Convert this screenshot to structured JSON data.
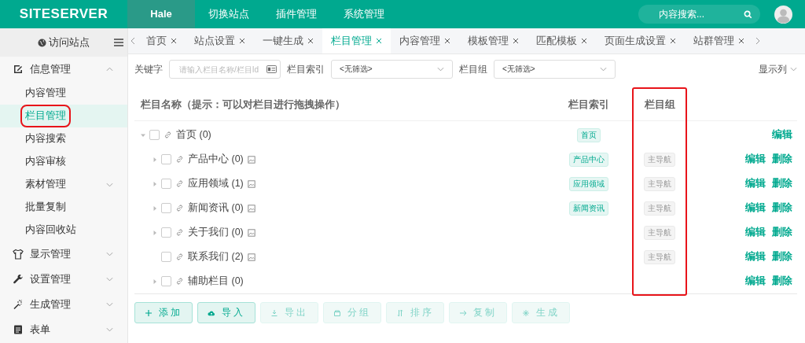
{
  "header": {
    "logo": "SITESERVER",
    "nav": [
      {
        "label": "Hale",
        "selected": true
      },
      {
        "label": "切换站点",
        "selected": false
      },
      {
        "label": "插件管理",
        "selected": false
      },
      {
        "label": "系统管理",
        "selected": false
      }
    ],
    "search": {
      "placeholder": "内容搜索..."
    }
  },
  "sidebar": {
    "visit": "访问站点",
    "groups": [
      {
        "label": "信息管理",
        "expanded": true,
        "items": [
          {
            "label": "内容管理",
            "selected": false,
            "highlighted": false,
            "expandable": false
          },
          {
            "label": "栏目管理",
            "selected": true,
            "highlighted": true,
            "expandable": false
          },
          {
            "label": "内容搜索",
            "selected": false,
            "highlighted": false,
            "expandable": false
          },
          {
            "label": "内容审核",
            "selected": false,
            "highlighted": false,
            "expandable": false
          },
          {
            "label": "素材管理",
            "selected": false,
            "highlighted": false,
            "expandable": true
          },
          {
            "label": "批量复制",
            "selected": false,
            "highlighted": false,
            "expandable": false
          },
          {
            "label": "内容回收站",
            "selected": false,
            "highlighted": false,
            "expandable": false
          }
        ]
      },
      {
        "label": "显示管理",
        "expanded": false
      },
      {
        "label": "设置管理",
        "expanded": false
      },
      {
        "label": "生成管理",
        "expanded": false
      },
      {
        "label": "表单",
        "expanded": false
      }
    ]
  },
  "tabs": [
    {
      "label": "首页",
      "selected": false
    },
    {
      "label": "站点设置",
      "selected": false
    },
    {
      "label": "一键生成",
      "selected": false
    },
    {
      "label": "栏目管理",
      "selected": true
    },
    {
      "label": "内容管理",
      "selected": false
    },
    {
      "label": "模板管理",
      "selected": false
    },
    {
      "label": "匹配模板",
      "selected": false
    },
    {
      "label": "页面生成设置",
      "selected": false
    },
    {
      "label": "站群管理",
      "selected": false
    }
  ],
  "filters": [
    {
      "label": "关键字",
      "kind": "input",
      "placeholder": "请输入栏目名称/栏目Id"
    },
    {
      "label": "栏目索引",
      "kind": "select",
      "value": "<无筛选>"
    },
    {
      "label": "栏目组",
      "kind": "select",
      "value": "<无筛选>"
    }
  ],
  "columns_toggle": "显示列",
  "table": {
    "columns": [
      {
        "label": "栏目名称（提示：可以对栏目进行拖拽操作）"
      },
      {
        "label": "栏目索引"
      },
      {
        "label": "栏目组",
        "highlighted": true
      }
    ],
    "rows": [
      {
        "name": "首页",
        "count": "(0)",
        "checked": false,
        "expandable": true,
        "expanded": true,
        "has_image": false,
        "index": "首页",
        "actions": [
          "编辑"
        ],
        "children": [
          {
            "name": "产品中心",
            "count": "(0)",
            "checked": false,
            "expandable": true,
            "has_image": true,
            "index": "产品中心",
            "group": "主导航",
            "actions": [
              "编辑",
              "删除"
            ]
          },
          {
            "name": "应用领域",
            "count": "(1)",
            "checked": false,
            "expandable": true,
            "has_image": true,
            "index": "应用领域",
            "group": "主导航",
            "actions": [
              "编辑",
              "删除"
            ]
          },
          {
            "name": "新闻资讯",
            "count": "(0)",
            "checked": false,
            "expandable": true,
            "has_image": true,
            "index": "新闻资讯",
            "group": "主导航",
            "actions": [
              "编辑",
              "删除"
            ]
          },
          {
            "name": "关于我们",
            "count": "(0)",
            "checked": false,
            "expandable": true,
            "has_image": true,
            "group": "主导航",
            "actions": [
              "编辑",
              "删除"
            ]
          },
          {
            "name": "联系我们",
            "count": "(2)",
            "checked": false,
            "expandable": false,
            "has_image": true,
            "group": "主导航",
            "actions": [
              "编辑",
              "删除"
            ]
          },
          {
            "name": "辅助栏目",
            "count": "(0)",
            "checked": false,
            "expandable": true,
            "has_image": false,
            "actions": [
              "编辑",
              "删除"
            ]
          }
        ]
      }
    ]
  },
  "buttons": [
    {
      "label": "添加",
      "disabled": false
    },
    {
      "label": "导入",
      "disabled": false
    },
    {
      "label": "导出",
      "disabled": true
    },
    {
      "label": "分组",
      "disabled": true
    },
    {
      "label": "排序",
      "disabled": true
    },
    {
      "label": "复制",
      "disabled": true
    },
    {
      "label": "生成",
      "disabled": true
    }
  ]
}
